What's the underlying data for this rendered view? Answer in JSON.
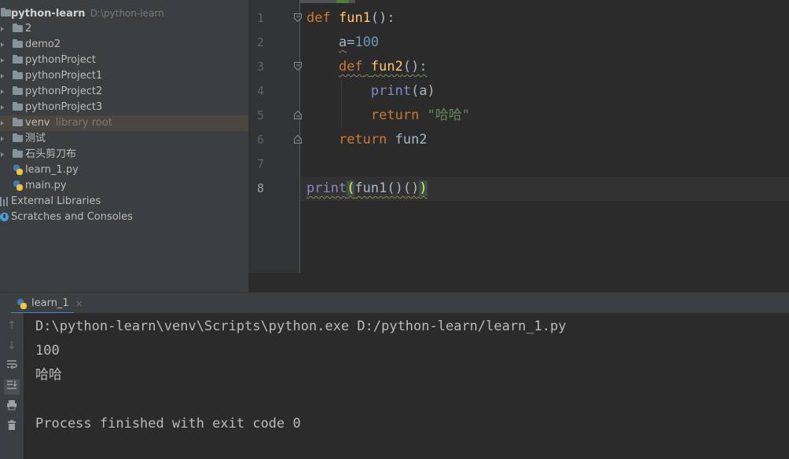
{
  "project": {
    "root_name": "python-learn",
    "root_path": "D:\\python-learn",
    "items": [
      {
        "label": "2",
        "kind": "folder"
      },
      {
        "label": "demo2",
        "kind": "folder"
      },
      {
        "label": "pythonProject",
        "kind": "folder"
      },
      {
        "label": "pythonProject1",
        "kind": "folder"
      },
      {
        "label": "pythonProject2",
        "kind": "folder"
      },
      {
        "label": "pythonProject3",
        "kind": "folder"
      },
      {
        "label": "venv",
        "kind": "folder",
        "hint": "library root",
        "selected": true
      },
      {
        "label": "测试",
        "kind": "folder"
      },
      {
        "label": "石头剪刀布",
        "kind": "folder"
      },
      {
        "label": "learn_1.py",
        "kind": "python-file"
      },
      {
        "label": "main.py",
        "kind": "python-file"
      }
    ],
    "external_libraries": "External Libraries",
    "scratches": "Scratches and Consoles"
  },
  "editor": {
    "line_numbers": [
      "1",
      "2",
      "3",
      "4",
      "5",
      "6",
      "7",
      "8"
    ],
    "current_line": "8",
    "code": {
      "l1_kw": "def",
      "l1_fn": "fun1",
      "l1_rest": "():",
      "l2_var": "a",
      "l2_eq": "=",
      "l2_num": "100",
      "l3_kw": "def",
      "l3_fn": "fun2",
      "l3_rest": "():",
      "l4_bi": "print",
      "l4_rest": "(a)",
      "l5_kw": "return",
      "l5_str": "\"哈哈\"",
      "l6_kw": "return",
      "l6_rest": "fun2",
      "l8_bi": "print",
      "l8_open": "(",
      "l8_mid": "fun1()()",
      "l8_close": ")"
    }
  },
  "run": {
    "tab_label": "learn_1",
    "tab_close": "×",
    "output": [
      "D:\\python-learn\\venv\\Scripts\\python.exe D:/python-learn/learn_1.py",
      "100",
      "哈哈",
      "",
      "Process finished with exit code 0"
    ]
  },
  "colors": {
    "editor_bg": "#2b2b2b",
    "panel_bg": "#3c3f41",
    "keyword": "#cc7832",
    "function": "#ffc66d",
    "number": "#6897bb",
    "builtin": "#8888c6",
    "string": "#6a8759"
  }
}
